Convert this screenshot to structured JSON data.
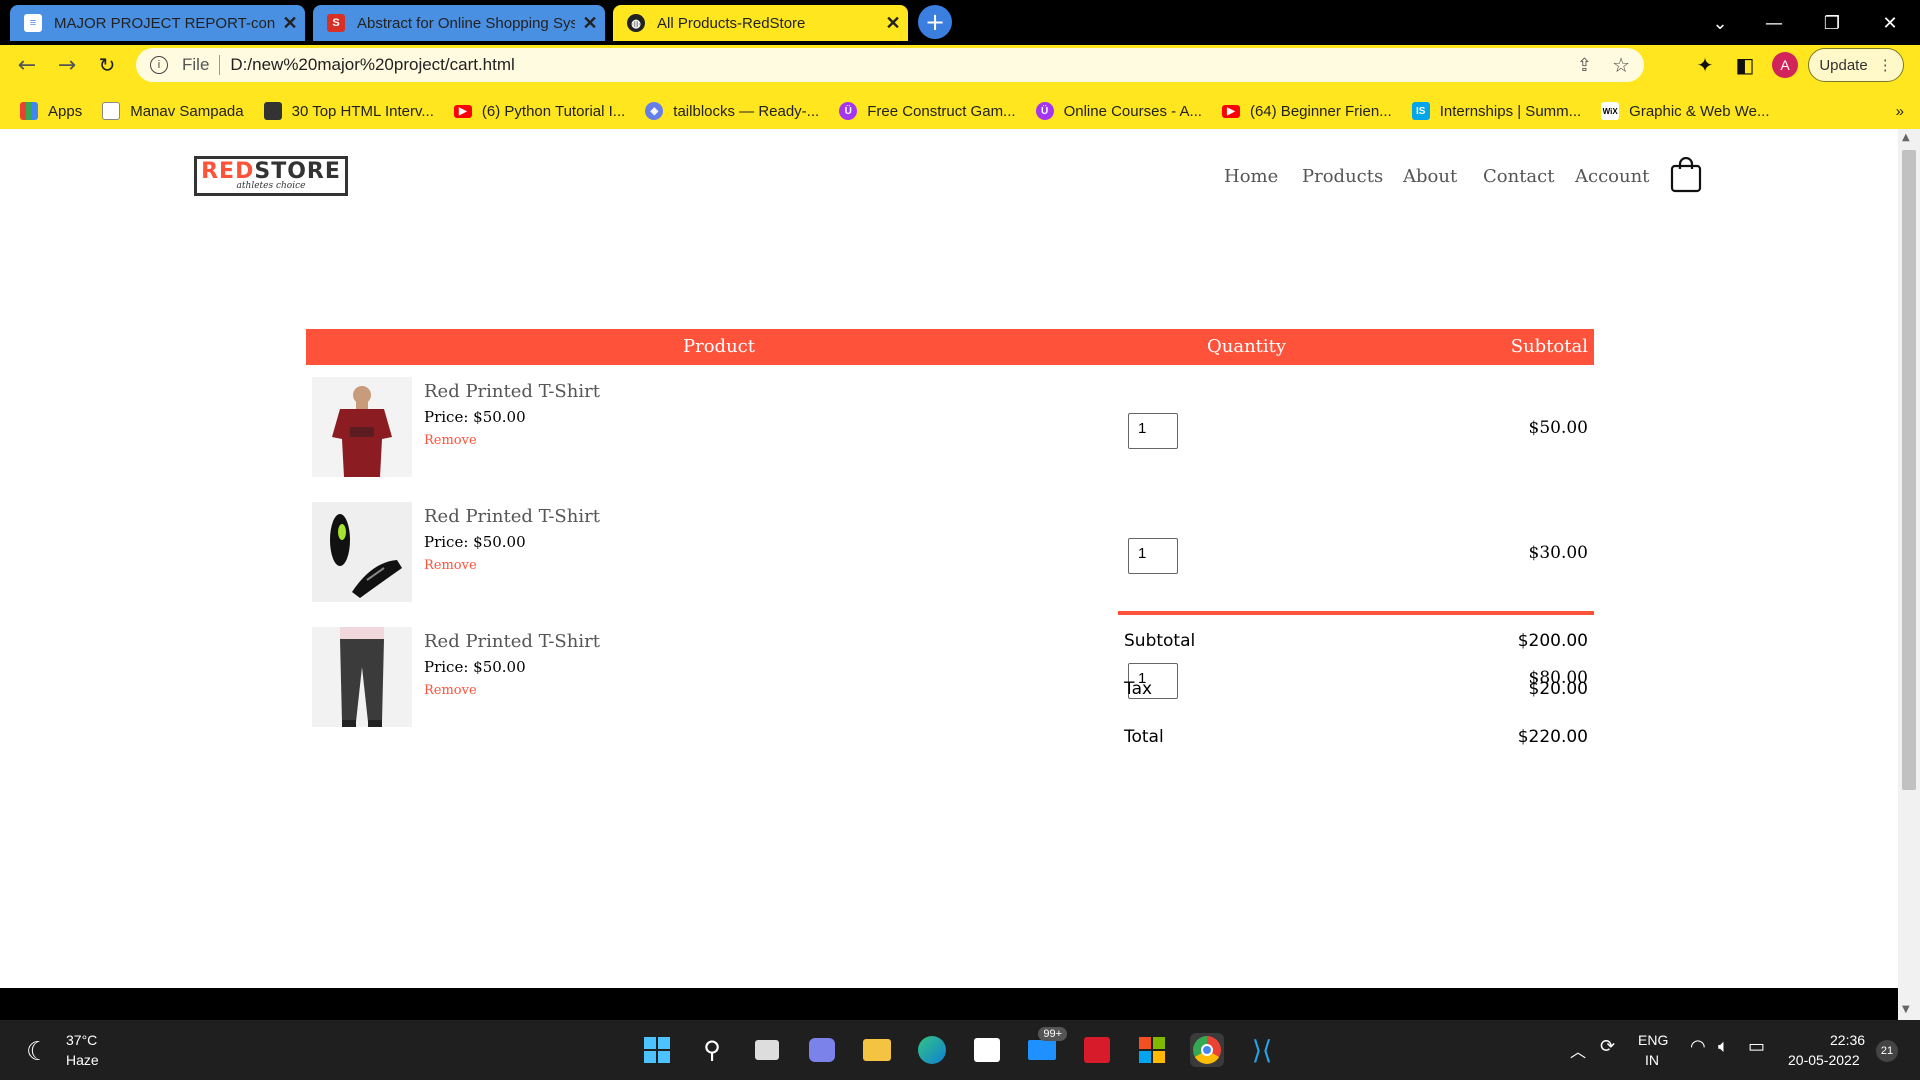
{
  "browser": {
    "tabs": [
      {
        "title": "MAJOR PROJECT REPORT-conver",
        "icon": "docs-icon"
      },
      {
        "title": "Abstract for Online Shopping Sys",
        "icon": "s-app-icon"
      },
      {
        "title": "All Products-RedStore",
        "icon": "globe-icon"
      }
    ],
    "address": {
      "scheme_label": "File",
      "url": "D:/new%20major%20project/cart.html"
    },
    "update_label": "Update",
    "profile_initial": "A",
    "bookmarks": [
      {
        "label": "Apps",
        "icon": "apps-grid-icon"
      },
      {
        "label": "Manav Sampada",
        "icon": "page-icon"
      },
      {
        "label": "30 Top HTML Interv...",
        "icon": "site-icon"
      },
      {
        "label": "(6) Python Tutorial I...",
        "icon": "youtube-icon"
      },
      {
        "label": "tailblocks — Ready-...",
        "icon": "tailblocks-icon"
      },
      {
        "label": "Free Construct Gam...",
        "icon": "udemy-icon"
      },
      {
        "label": "Online Courses - A...",
        "icon": "udemy-icon"
      },
      {
        "label": "(64) Beginner Frien...",
        "icon": "youtube-icon"
      },
      {
        "label": "Internships | Summ...",
        "icon": "internshala-icon"
      },
      {
        "label": "Graphic & Web We...",
        "icon": "wix-icon"
      }
    ],
    "overflow_label": "»"
  },
  "site": {
    "logo_main_a": "RED",
    "logo_main_b": "STORE",
    "logo_tagline": "athletes choice",
    "nav": [
      "Home",
      "Products",
      "About",
      "Contact",
      "Account"
    ],
    "colors": {
      "accent": "#ff523b"
    }
  },
  "cart": {
    "headers": {
      "product": "Product",
      "quantity": "Quantity",
      "subtotal": "Subtotal"
    },
    "items": [
      {
        "name": "Red Printed T-Shirt",
        "price": "Price: $50.00",
        "remove": "Remove",
        "qty": "1",
        "subtotal": "$50.00",
        "image": "red-tshirt"
      },
      {
        "name": "Red Printed T-Shirt",
        "price": "Price: $50.00",
        "remove": "Remove",
        "qty": "1",
        "subtotal": "$30.00",
        "image": "black-shoes"
      },
      {
        "name": "Red Printed T-Shirt",
        "price": "Price: $50.00",
        "remove": "Remove",
        "qty": "1",
        "subtotal": "$80.00",
        "image": "grey-joggers"
      }
    ],
    "totals": [
      {
        "label": "Subtotal",
        "value": "$200.00"
      },
      {
        "label": "Tax",
        "value": "$20.00"
      },
      {
        "label": "Total",
        "value": "$220.00"
      }
    ]
  },
  "taskbar": {
    "weather_temp": "37°C",
    "weather_desc": "Haze",
    "mail_badge": "99+",
    "lang": "ENG",
    "region": "IN",
    "time": "22:36",
    "date": "20-05-2022",
    "notif_count": "21"
  }
}
